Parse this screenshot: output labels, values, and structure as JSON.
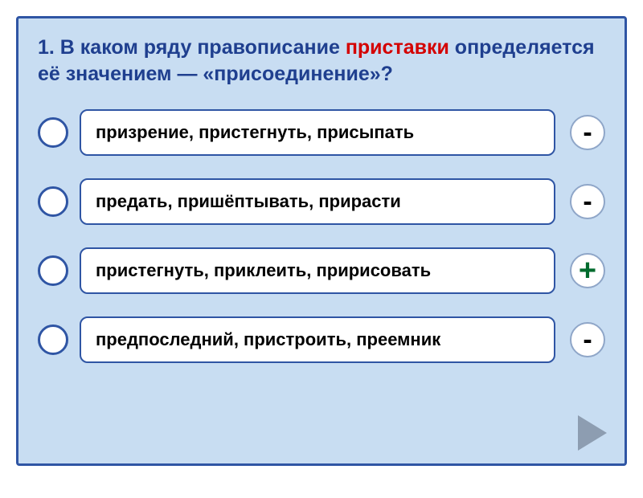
{
  "question": {
    "prefix": "1. В каком ряду правописание ",
    "highlight": "приставки",
    "suffix": " определяется её значением — «присоединение»?"
  },
  "options": [
    {
      "text": "призрение, пристегнуть, присыпать",
      "mark": "-",
      "correct": false
    },
    {
      "text": "предать, пришёптывать, прирасти",
      "mark": "-",
      "correct": false
    },
    {
      "text": "пристегнуть, приклеить, пририсовать",
      "mark": "+",
      "correct": true
    },
    {
      "text": "предпоследний, пристроить, преемник",
      "mark": "-",
      "correct": false
    }
  ]
}
